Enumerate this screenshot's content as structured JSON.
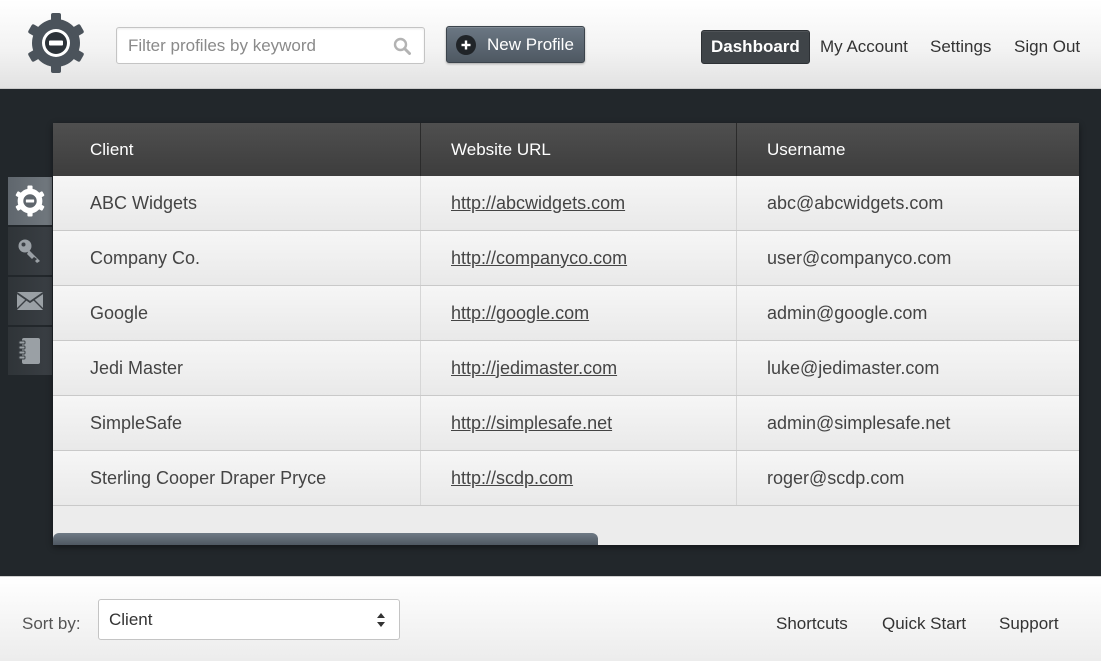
{
  "header": {
    "logo_icon": "gear-icon",
    "search": {
      "placeholder": "Filter profiles by keyword",
      "value": "",
      "icon": "search-icon"
    },
    "new_profile_label": "New Profile",
    "nav": [
      {
        "label": "Dashboard",
        "active": true
      },
      {
        "label": "My Account"
      },
      {
        "label": "Settings"
      },
      {
        "label": "Sign Out"
      }
    ]
  },
  "sidebar": {
    "tabs": [
      {
        "icon": "gear-icon",
        "active": true
      },
      {
        "icon": "key-icon"
      },
      {
        "icon": "envelope-icon"
      },
      {
        "icon": "notebook-icon"
      }
    ]
  },
  "table": {
    "columns": [
      "Client",
      "Website URL",
      "Username"
    ],
    "rows": [
      {
        "client": "ABC Widgets",
        "url": "http://abcwidgets.com",
        "username": "abc@abcwidgets.com"
      },
      {
        "client": "Company Co.",
        "url": "http://companyco.com",
        "username": "user@companyco.com"
      },
      {
        "client": "Google",
        "url": "http://google.com",
        "username": "admin@google.com"
      },
      {
        "client": "Jedi Master",
        "url": "http://jedimaster.com",
        "username": "luke@jedimaster.com"
      },
      {
        "client": "SimpleSafe",
        "url": "http://simplesafe.net",
        "username": "admin@simplesafe.net"
      },
      {
        "client": "Sterling Cooper Draper Pryce",
        "url": "http://scdp.com",
        "username": "roger@scdp.com"
      }
    ]
  },
  "footer": {
    "sort_label": "Sort by:",
    "sort_value": "Client",
    "links": [
      "Shortcuts",
      "Quick Start",
      "Support"
    ]
  },
  "colors": {
    "background": "#22272b",
    "table_header": "#474747",
    "button": "#5a646e",
    "active_nav": "#3f4448"
  }
}
